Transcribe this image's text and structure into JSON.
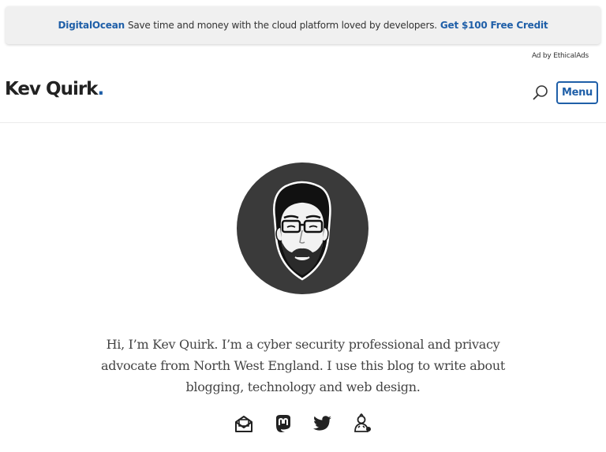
{
  "ad": {
    "brand": "DigitalOcean",
    "text": "Save time and money with the cloud platform loved by developers.",
    "cta": "Get $100 Free Credit",
    "attribution": "Ad by EthicalAds"
  },
  "header": {
    "title": "Kev Quirk",
    "title_dot": ".",
    "menu_label": "Menu",
    "search_icon": "search-icon"
  },
  "intro": {
    "line1": "Hi, I’m Kev Quirk. I’m a cyber security professional and privacy",
    "line2": "advocate from North West England. I use this blog to write about",
    "line3": "blogging, technology and web design."
  },
  "social": {
    "icons": [
      "email-icon",
      "mastodon-icon",
      "twitter-icon",
      "profile-icon"
    ]
  },
  "colors": {
    "accent": "#1f5fa8",
    "avatar_bg": "#3a3a3a",
    "ad_bg": "#f0f0f0"
  }
}
